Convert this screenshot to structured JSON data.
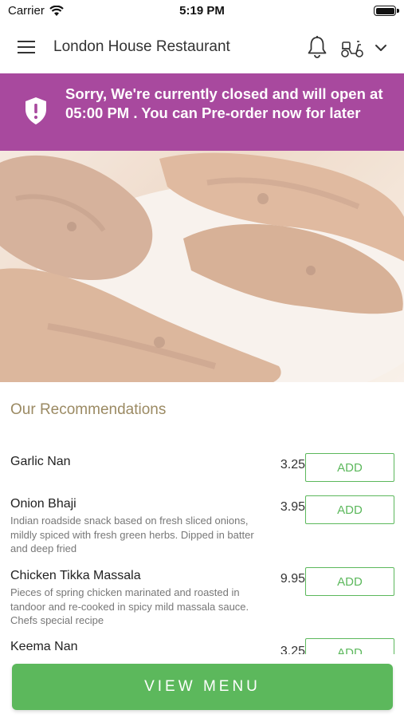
{
  "status_bar": {
    "carrier": "Carrier",
    "time": "5:19 PM"
  },
  "header": {
    "title": "London House Restaurant"
  },
  "banner": {
    "text": "Sorry, We're currently closed and will open at 05:00 PM . You can Pre-order now for later",
    "color": "#a8499e"
  },
  "recommendations": {
    "title": "Our Recommendations",
    "add_label": "ADD",
    "items": [
      {
        "name": "Garlic Nan",
        "description": "",
        "price": "3.25"
      },
      {
        "name": "Onion Bhaji",
        "description": "Indian roadside snack based on fresh sliced onions, mildly spiced with fresh green herbs. Dipped in batter and deep fried",
        "price": "3.95"
      },
      {
        "name": "Chicken Tikka Massala",
        "description": "Pieces of spring chicken marinated and roasted in tandoor and re-cooked in spicy mild massala sauce. Chefs special recipe",
        "price": "9.95"
      },
      {
        "name": "Keema Nan",
        "description": "",
        "price": "3.25"
      }
    ]
  },
  "footer": {
    "view_menu_label": "VIEW MENU"
  },
  "colors": {
    "accent": "#5cb85c",
    "section_title": "#9b8a63"
  },
  "icons": [
    "wifi-icon",
    "battery-icon",
    "hamburger-icon",
    "bell-icon",
    "scooter-icon",
    "chevron-down-icon",
    "shield-alert-icon"
  ]
}
